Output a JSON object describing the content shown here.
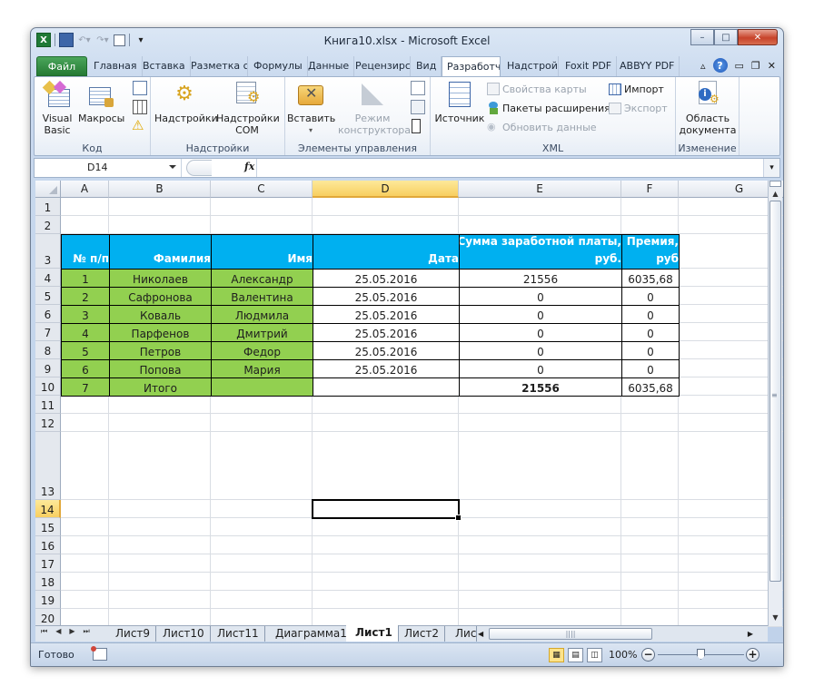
{
  "titlebar": {
    "title": "Книга10.xlsx  -  Microsoft Excel",
    "qat_icons": [
      "excel-logo",
      "save-icon",
      "undo-icon",
      "redo-icon",
      "form-icon",
      "customize-qat-icon"
    ],
    "window_buttons": {
      "minimize": "–",
      "maximize": "□",
      "close": "✕"
    }
  },
  "tabs": [
    {
      "label": "Файл",
      "type": "file"
    },
    {
      "label": "Главная"
    },
    {
      "label": "Вставка"
    },
    {
      "label": "Разметка с"
    },
    {
      "label": "Формулы"
    },
    {
      "label": "Данные"
    },
    {
      "label": "Рецензирс"
    },
    {
      "label": "Вид"
    },
    {
      "label": "Разработч",
      "active": true
    },
    {
      "label": "Надстройк"
    },
    {
      "label": "Foxit PDF"
    },
    {
      "label": "ABBYY PDF"
    }
  ],
  "tab_icons": {
    "collapse": "▵",
    "help": "?",
    "min": "▭",
    "restore": "❐",
    "close": "✕"
  },
  "ribbon": {
    "groups": {
      "code": {
        "label": "Код",
        "visual_basic": "Visual Basic",
        "macros": "Макросы"
      },
      "addins": {
        "label": "Надстройки",
        "addins": "Надстройки",
        "com_addins": "Надстройки COM"
      },
      "controls": {
        "label": "Элементы управления",
        "insert": "Вставить",
        "design_mode": "Режим конструктора"
      },
      "xml": {
        "label": "XML",
        "source": "Источник",
        "map_properties": "Свойства карты",
        "expansion_packs": "Пакеты расширения",
        "refresh_data": "Обновить данные",
        "import": "Импорт",
        "export": "Экспорт"
      },
      "modify": {
        "label": "Изменение",
        "document_panel": "Область документа"
      }
    }
  },
  "formula_bar": {
    "name_box": "D14",
    "fx_label": "fx",
    "formula": ""
  },
  "sheet": {
    "columns": [
      "A",
      "B",
      "C",
      "D",
      "E",
      "F",
      "G"
    ],
    "selected_column": "D",
    "rows": [
      "1",
      "2",
      "3",
      "4",
      "5",
      "6",
      "7",
      "8",
      "9",
      "10",
      "11",
      "12",
      "13",
      "14",
      "15",
      "16",
      "17",
      "18",
      "19",
      "20"
    ],
    "selected_row": "14",
    "selected_cell": "D14",
    "header": [
      "№ п/п",
      "Фамилия",
      "Имя",
      "Дата",
      "Сумма заработной платы, руб.",
      "Премия, руб"
    ],
    "header_lines": {
      "e": [
        "Сумма заработной платы,",
        "руб."
      ],
      "f": [
        "Премия,",
        "руб"
      ]
    },
    "data": [
      [
        "1",
        "Николаев",
        "Александр",
        "25.05.2016",
        "21556",
        "6035,68"
      ],
      [
        "2",
        "Сафронова",
        "Валентина",
        "25.05.2016",
        "0",
        "0"
      ],
      [
        "3",
        "Коваль",
        "Людмила",
        "25.05.2016",
        "0",
        "0"
      ],
      [
        "4",
        "Парфенов",
        "Дмитрий",
        "25.05.2016",
        "0",
        "0"
      ],
      [
        "5",
        "Петров",
        "Федор",
        "25.05.2016",
        "0",
        "0"
      ],
      [
        "6",
        "Попова",
        "Мария",
        "25.05.2016",
        "0",
        "0"
      ]
    ],
    "total": [
      "7",
      "Итого",
      "",
      "",
      "21556",
      "6035,68"
    ],
    "colors": {
      "header_fill": "#00b0f0",
      "green_fill": "#92d050",
      "selection_highlight": "#f8cf60"
    }
  },
  "sheet_tabs": {
    "nav": [
      "⏮",
      "◀",
      "▶",
      "⏭"
    ],
    "tabs": [
      "Лист9",
      "Лист10",
      "Лист11",
      "Диаграмма1",
      "Лист1",
      "Лист2",
      "Лис"
    ],
    "active": "Лист1"
  },
  "statusbar": {
    "status": "Готово",
    "zoom": "100%",
    "zoom_level_percent": 100,
    "view_mode": "normal"
  }
}
